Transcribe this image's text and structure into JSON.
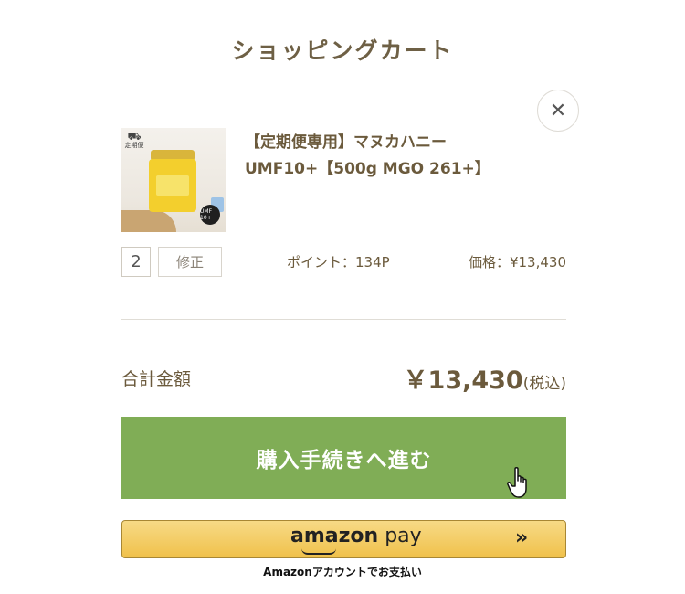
{
  "header": {
    "title": "ショッピングカート"
  },
  "cart_item": {
    "name_line1": "【定期便専用】マヌカハニー",
    "name_line2": "UMF10+【500g MGO 261+】",
    "thumb_tag": "定期便",
    "thumb_badge": "UMF 10+",
    "quantity": "2",
    "edit_label": "修正",
    "points": "ポイント：134P",
    "price": "価格：¥13,430"
  },
  "summary": {
    "total_label": "合計金額",
    "total_amount": "￥13,430",
    "tax_note": "(税込)"
  },
  "actions": {
    "checkout_label": "購入手続きへ進む",
    "amazon_word": "amazon",
    "amazon_pay": " pay",
    "amazon_caption": "Amazonアカウントでお支払い"
  },
  "colors": {
    "checkout_green": "#80ad56",
    "amazon_gold": "#f0c14b",
    "text_brown": "#6b5a3c"
  },
  "icons": [
    "close-icon",
    "truck-icon",
    "hand-cursor-icon",
    "double-chevron-icon"
  ]
}
